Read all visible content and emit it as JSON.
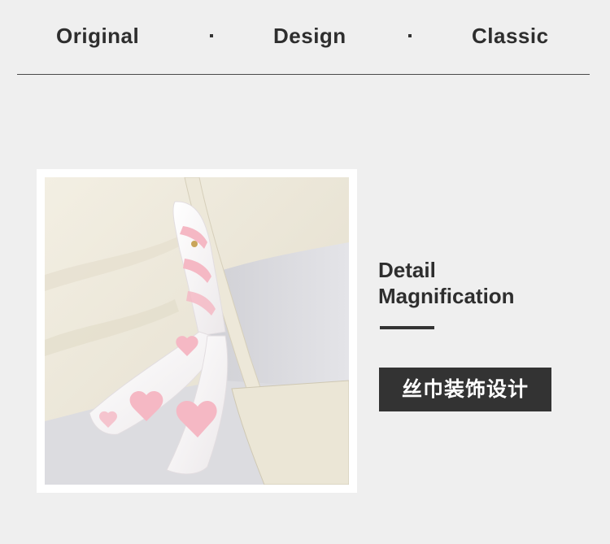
{
  "header": {
    "words": [
      "Original",
      "Design",
      "Classic"
    ],
    "separator": "·"
  },
  "detail": {
    "title_line1": "Detail",
    "title_line2": "Magnification"
  },
  "badge": {
    "label": "丝巾装饰设计"
  },
  "colors": {
    "background": "#efefef",
    "text": "#2e2e2e",
    "badge_bg": "#333333",
    "badge_text": "#ffffff",
    "bag_cream": "#ece7d8",
    "scarf_pink": "#f5b8c4"
  }
}
